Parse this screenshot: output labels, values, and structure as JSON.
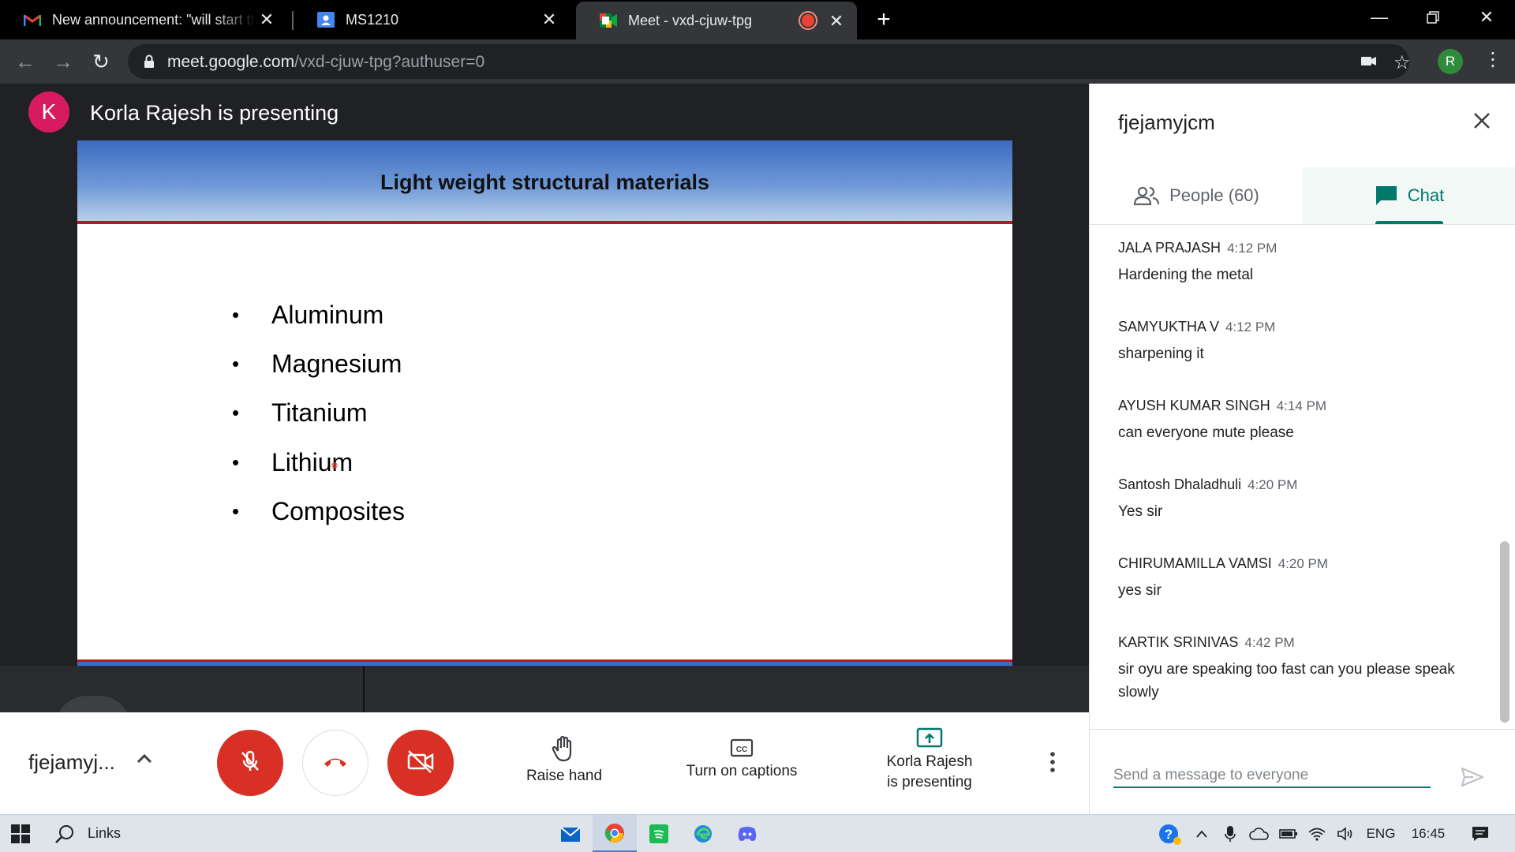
{
  "browser": {
    "tabs": [
      {
        "title": "New announcement: \"will start the",
        "icon": "gmail-icon",
        "active": false
      },
      {
        "title": "MS1210",
        "icon": "classroom-icon",
        "active": false
      },
      {
        "title": "Meet - vxd-cjuw-tpg",
        "icon": "meet-icon",
        "active": true,
        "recording": true
      }
    ],
    "url_host": "meet.google.com",
    "url_path": "/vxd-cjuw-tpg?authuser=0",
    "profile_initial": "R",
    "profile_color": "#2e8b3a"
  },
  "meet": {
    "presenter_initial": "K",
    "presenter_color": "#d81b60",
    "presenter_label": "Korla Rajesh is presenting",
    "slide": {
      "title": "Light weight structural materials",
      "bullets": [
        "Aluminum",
        "Magnesium",
        "Titanium",
        "Lithium",
        "Composites"
      ]
    },
    "controls": {
      "meeting_code": "fjejamyj...",
      "raise_hand": "Raise hand",
      "captions": "Turn on captions",
      "presenting_line1": "Korla Rajesh",
      "presenting_line2": "is presenting",
      "danger_color": "#d93025"
    }
  },
  "panel": {
    "title": "fjejamyjcm",
    "tab_people": "People (60)",
    "tab_chat": "Chat",
    "accent_color": "#00796b",
    "messages": [
      {
        "name": "JALA PRAJASH",
        "time": "4:12 PM",
        "text": "Hardening the metal"
      },
      {
        "name": "SAMYUKTHA V",
        "time": "4:12 PM",
        "text": "sharpening it"
      },
      {
        "name": "AYUSH KUMAR SINGH",
        "time": "4:14 PM",
        "text": "can everyone mute please"
      },
      {
        "name": "Santosh Dhaladhuli",
        "time": "4:20 PM",
        "text": "Yes sir"
      },
      {
        "name": "CHIRUMAMILLA VAMSI",
        "time": "4:20 PM",
        "text": "yes sir"
      },
      {
        "name": "KARTIK SRINIVAS",
        "time": "4:42 PM",
        "text": "sir oyu are speaking too fast can you please speak slowly"
      }
    ],
    "composer_placeholder": "Send a message to everyone"
  },
  "taskbar": {
    "search_label": "Links",
    "language": "ENG",
    "clock": "16:45"
  }
}
